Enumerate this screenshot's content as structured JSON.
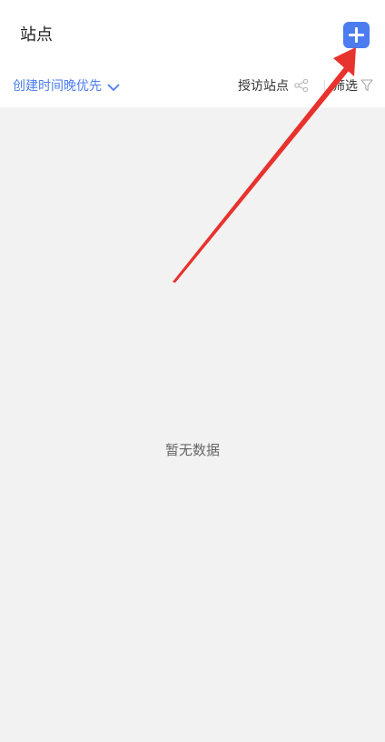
{
  "header": {
    "title": "站点",
    "add_icon": "plus-icon",
    "accent_color": "#4b7cf0"
  },
  "toolbar": {
    "sort_label": "创建时间晚优先",
    "sort_icon": "chevron-down-icon",
    "visit_label": "授访站点",
    "visit_icon": "share-icon",
    "filter_label": "筛选",
    "filter_icon": "filter-icon"
  },
  "main": {
    "empty_text": "暂无数据"
  },
  "annotation": {
    "icon": "red-arrow-icon",
    "color": "#e8322e"
  }
}
